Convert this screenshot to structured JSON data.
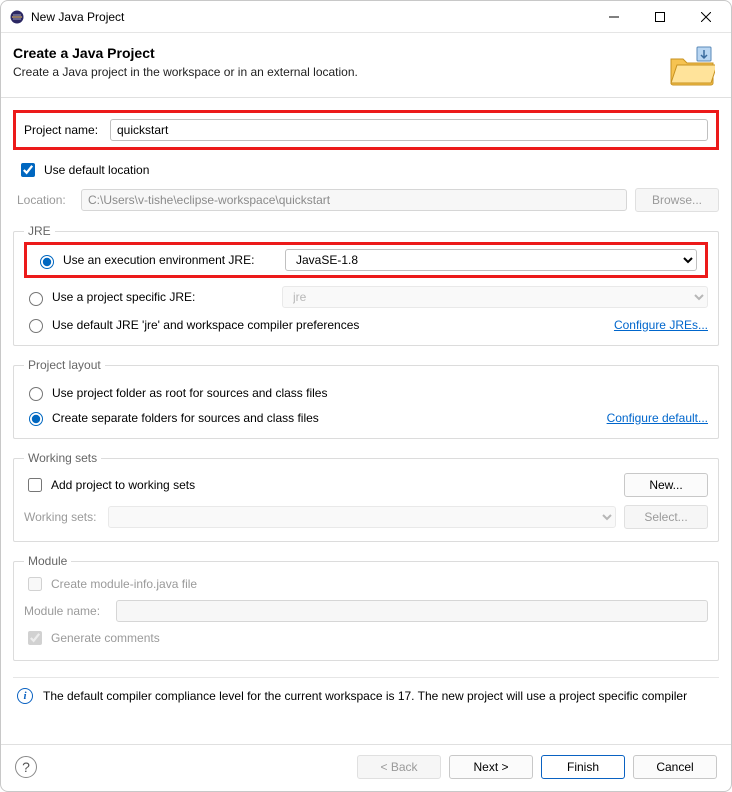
{
  "window": {
    "title": "New Java Project"
  },
  "header": {
    "heading": "Create a Java Project",
    "sub": "Create a Java project in the workspace or in an external location."
  },
  "projectName": {
    "label": "Project name:",
    "value": "quickstart"
  },
  "defaultLocation": {
    "label": "Use default location",
    "checked": true
  },
  "location": {
    "label": "Location:",
    "value": "C:\\Users\\v-tishe\\eclipse-workspace\\quickstart",
    "browse": "Browse..."
  },
  "jre": {
    "legend": "JRE",
    "opt1": "Use an execution environment JRE:",
    "opt1_value": "JavaSE-1.8",
    "opt2": "Use a project specific JRE:",
    "opt2_value": "jre",
    "opt3": "Use default JRE 'jre' and workspace compiler preferences",
    "link": "Configure JREs..."
  },
  "layout": {
    "legend": "Project layout",
    "opt1": "Use project folder as root for sources and class files",
    "opt2": "Create separate folders for sources and class files",
    "link": "Configure default..."
  },
  "workingSets": {
    "legend": "Working sets",
    "add": "Add project to working sets",
    "newBtn": "New...",
    "label": "Working sets:",
    "selectBtn": "Select..."
  },
  "module": {
    "legend": "Module",
    "create": "Create module-info.java file",
    "nameLabel": "Module name:",
    "nameValue": "",
    "generate": "Generate comments"
  },
  "info": {
    "text": "The default compiler compliance level for the current workspace is 17. The new project will use a project specific compiler"
  },
  "footer": {
    "back": "< Back",
    "next": "Next >",
    "finish": "Finish",
    "cancel": "Cancel"
  }
}
